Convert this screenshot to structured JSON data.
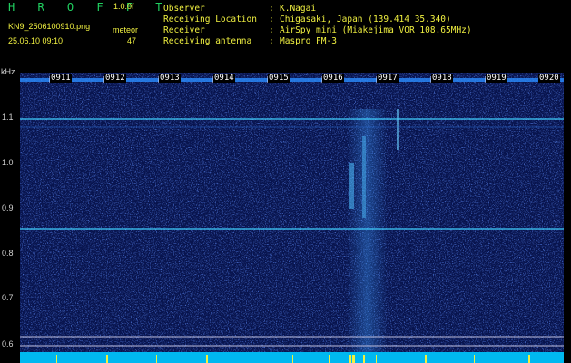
{
  "header": {
    "brand": "H R O F F T",
    "version": "1.0.0f",
    "filename": "KN9_2506100910.png",
    "meteor_label": "meteor",
    "datetime": "25.06.10 09:10",
    "meteor_count": "47"
  },
  "info": [
    {
      "key": "Observer",
      "value": "K.Nagai"
    },
    {
      "key": "Receiving Location",
      "value": "Chigasaki, Japan (139.414 35.340)"
    },
    {
      "key": "Receiver",
      "value": "AirSpy mini (Miakejima VOR 108.65MHz)"
    },
    {
      "key": "Receiving antenna",
      "value": "Maspro FM-3"
    }
  ],
  "plot": {
    "y_unit": "kHz",
    "y_labels": [
      "1.1",
      "1.0",
      "0.9",
      "0.8",
      "0.7",
      "0.6"
    ],
    "time_labels": [
      "0911",
      "0912",
      "0913",
      "0914",
      "0915",
      "0916",
      "0917",
      "0918",
      "0919",
      "0920"
    ],
    "colors": {
      "background": "#000000",
      "noise_dark": "#0a1a6a",
      "noise_mid": "#1e4ad0",
      "noise_bright": "#3fa0ff",
      "trace": "#40d0ff",
      "strip": "#00b8f0",
      "peak": "#f0f040"
    }
  }
}
